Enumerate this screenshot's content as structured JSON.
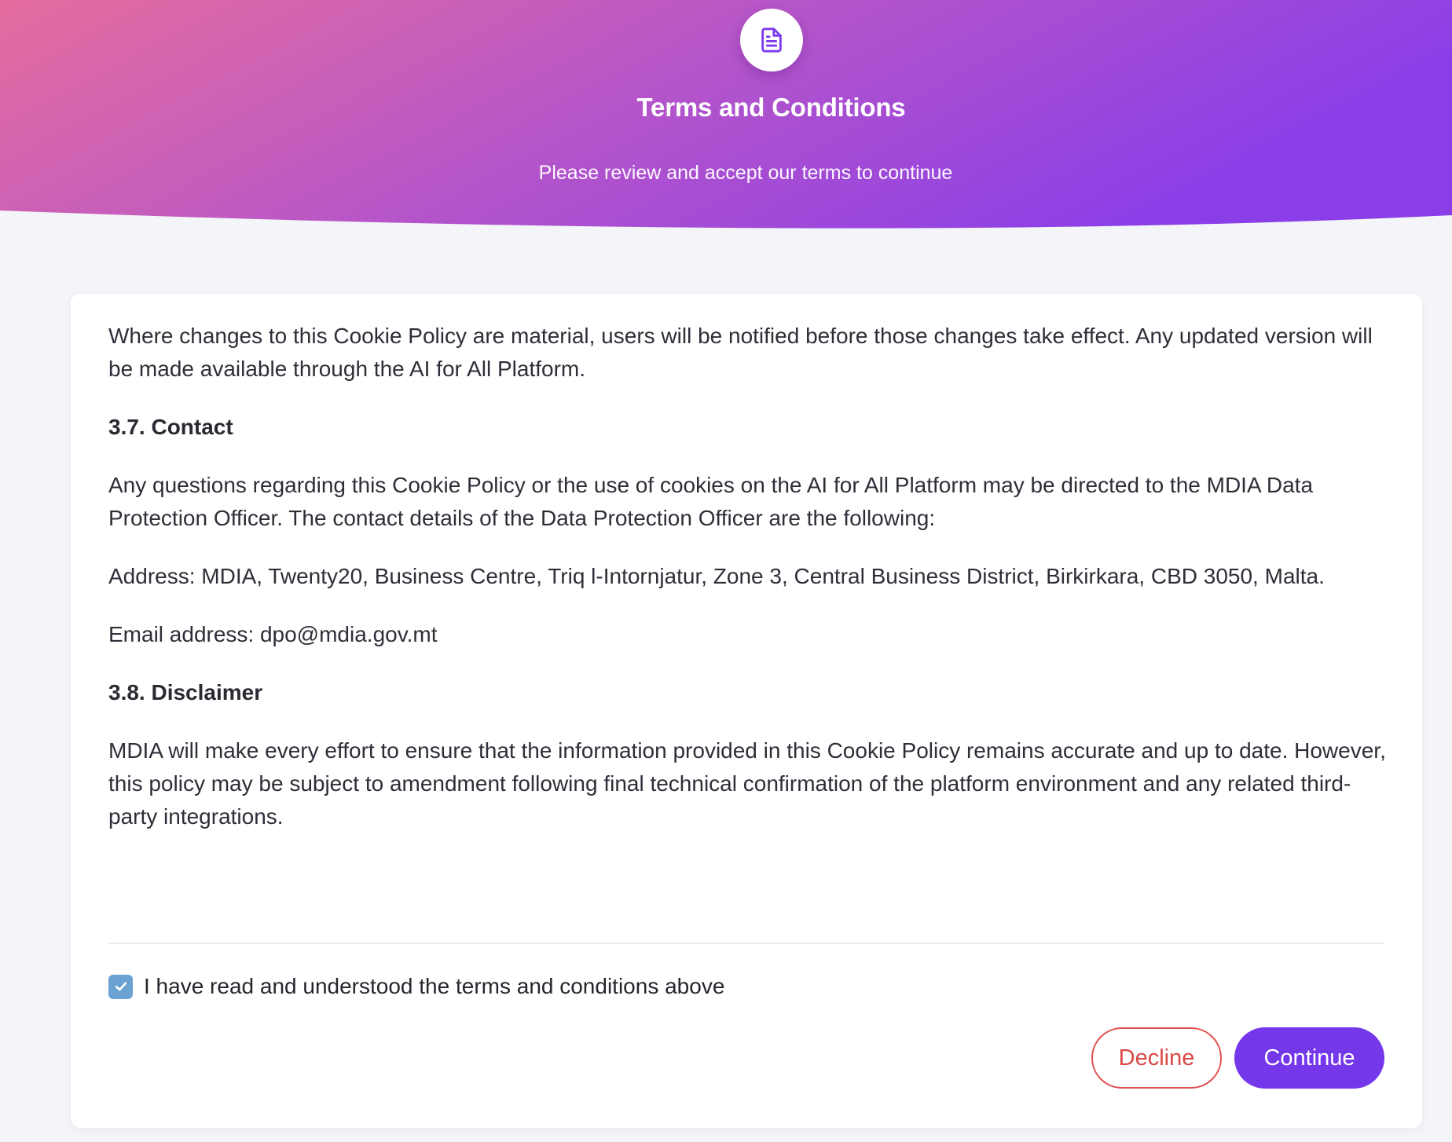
{
  "header": {
    "icon": "document-icon",
    "title": "Terms and Conditions",
    "subtitle": "Please review and accept our terms to continue",
    "gradient_start": "#e56d9e",
    "gradient_end": "#8a3ee8"
  },
  "content": {
    "intro_paragraph": "Where changes to this Cookie Policy are material, users will be notified before those changes take effect. Any updated version will be made available through the AI for All Platform.",
    "section_contact": {
      "heading": "3.7. Contact",
      "paragraph": "Any questions regarding this Cookie Policy or the use of cookies on the AI for All Platform may be directed to the MDIA Data Protection Officer. The contact details of the Data Protection Officer are the following:",
      "address": "Address: MDIA, Twenty20, Business Centre, Triq l-Intornjatur, Zone 3, Central Business District, Birkirkara, CBD 3050, Malta.",
      "email": "Email address: dpo@mdia.gov.mt"
    },
    "section_disclaimer": {
      "heading": "3.8. Disclaimer",
      "paragraph": "MDIA will make every effort to ensure that the information provided in this Cookie Policy remains accurate and up to date. However, this policy may be subject to amendment following final technical confirmation of the platform environment and any related third-party integrations."
    }
  },
  "acknowledgement": {
    "checked": true,
    "label": "I have read and understood the terms and conditions above"
  },
  "actions": {
    "decline_label": "Decline",
    "continue_label": "Continue",
    "decline_color": "#d94745",
    "continue_color": "#7438ea"
  }
}
